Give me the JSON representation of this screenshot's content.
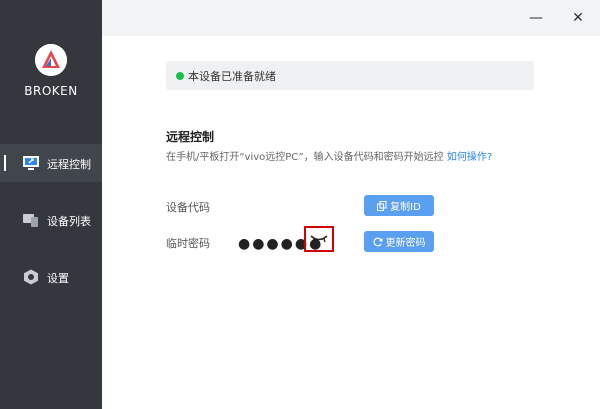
{
  "app": {
    "brand": "BROKEN"
  },
  "sidebar": {
    "items": [
      {
        "label": "远程控制",
        "icon": "remote-control-icon",
        "active": true
      },
      {
        "label": "设备列表",
        "icon": "device-list-icon",
        "active": false
      },
      {
        "label": "设置",
        "icon": "settings-icon",
        "active": false
      }
    ]
  },
  "window": {
    "minimize": "—",
    "close": "✕"
  },
  "status": {
    "text": "本设备已准备就绪",
    "color": "#1bbe4b"
  },
  "remote": {
    "title": "远程控制",
    "description": "在手机/平板打开“vivo远控PC”，输入设备代码和密码开始远控",
    "help_link": "如何操作?",
    "device_code_label": "设备代码",
    "copy_button": "复制ID",
    "temp_password_label": "临时密码",
    "password_mask": "●●●●●●",
    "refresh_button": "更新密码"
  },
  "colors": {
    "sidebar_bg": "#34373e",
    "accent": "#5b9ff0",
    "highlight_border": "#d40000"
  }
}
